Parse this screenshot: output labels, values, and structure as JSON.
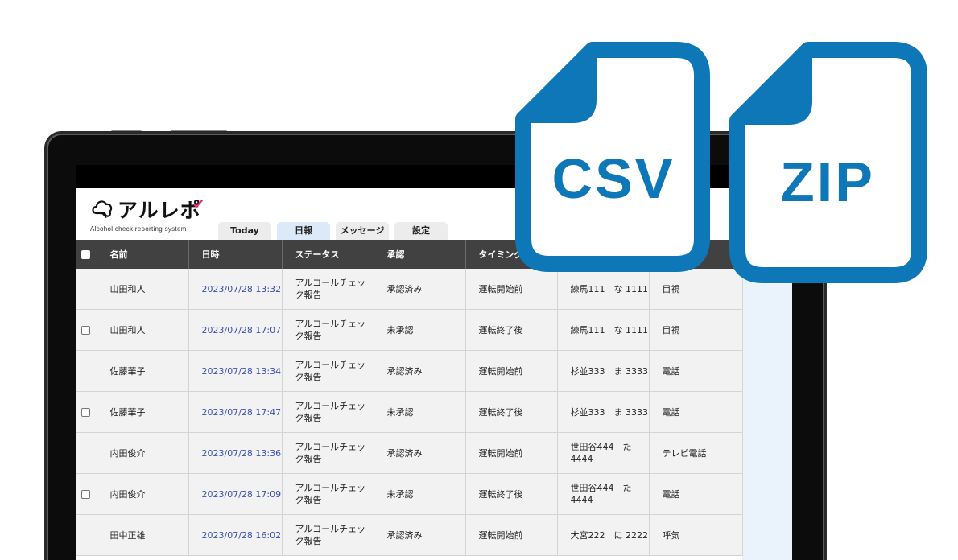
{
  "app": {
    "logo_text": "アルレポ",
    "logo_subtitle": "Alcohol check reporting system"
  },
  "tabs": [
    {
      "label": "Today",
      "active": false
    },
    {
      "label": "日報",
      "active": true
    },
    {
      "label": "メッセージ",
      "active": false
    },
    {
      "label": "設定",
      "active": false
    }
  ],
  "table": {
    "columns": [
      "名前",
      "日時",
      "ステータス",
      "承認",
      "タイミング",
      "",
      ""
    ],
    "rows": [
      {
        "checkbox": false,
        "name": "山田和人",
        "datetime": "2023/07/28 13:32",
        "status": "アルコールチェック報告",
        "approval": "承認済み",
        "timing": "運転開始前",
        "vehicle": "練馬111　な 1111",
        "method": "目視"
      },
      {
        "checkbox": true,
        "name": "山田和人",
        "datetime": "2023/07/28 17:07",
        "status": "アルコールチェック報告",
        "approval": "未承認",
        "timing": "運転終了後",
        "vehicle": "練馬111　な 1111",
        "method": "目視"
      },
      {
        "checkbox": false,
        "name": "佐藤華子",
        "datetime": "2023/07/28 13:34",
        "status": "アルコールチェック報告",
        "approval": "承認済み",
        "timing": "運転開始前",
        "vehicle": "杉並333　ま 3333",
        "method": "電話"
      },
      {
        "checkbox": true,
        "name": "佐藤華子",
        "datetime": "2023/07/28 17:47",
        "status": "アルコールチェック報告",
        "approval": "未承認",
        "timing": "運転終了後",
        "vehicle": "杉並333　ま 3333",
        "method": "電話"
      },
      {
        "checkbox": false,
        "name": "内田俊介",
        "datetime": "2023/07/28 13:36",
        "status": "アルコールチェック報告",
        "approval": "承認済み",
        "timing": "運転開始前",
        "vehicle": "世田谷444　た 4444",
        "method": "テレビ電話"
      },
      {
        "checkbox": true,
        "name": "内田俊介",
        "datetime": "2023/07/28 17:09",
        "status": "アルコールチェック報告",
        "approval": "未承認",
        "timing": "運転終了後",
        "vehicle": "世田谷444　た 4444",
        "method": "電話"
      },
      {
        "checkbox": false,
        "name": "田中正雄",
        "datetime": "2023/07/28 16:02",
        "status": "アルコールチェック報告",
        "approval": "承認済み",
        "timing": "運転開始前",
        "vehicle": "大宮222　に 2222",
        "method": "呼気"
      }
    ]
  },
  "file_icons": [
    {
      "label": "CSV",
      "color": "#0d77b7"
    },
    {
      "label": "ZIP",
      "color": "#0d77b7"
    }
  ],
  "colors": {
    "header_bg": "#414141",
    "link_date": "#3a4fb0",
    "active_tab": "#dbe9f8",
    "icon_blue": "#0d77b7",
    "logo_accent": "#e8356b"
  }
}
